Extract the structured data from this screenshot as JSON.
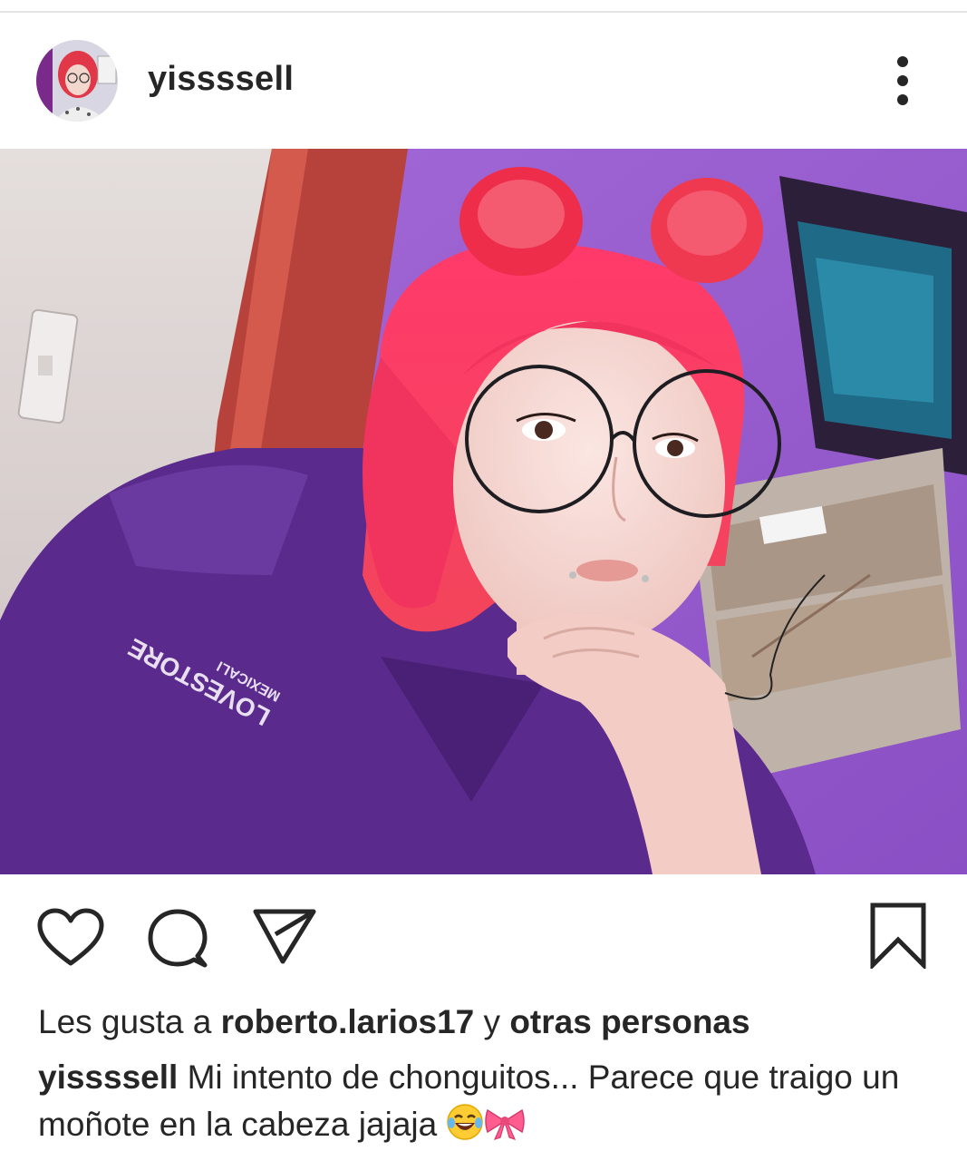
{
  "post": {
    "username": "yissssell",
    "more_icon": "more-vertical-icon"
  },
  "actions": {
    "like_icon": "heart-icon",
    "comment_icon": "comment-icon",
    "share_icon": "send-icon",
    "save_icon": "bookmark-icon"
  },
  "likes": {
    "prefix": "Les gusta a",
    "liker": "roberto.larios17",
    "joiner": "y",
    "others": "otras personas"
  },
  "caption": {
    "username": "yissssell",
    "text": "Mi intento de chonguitos... Parece que traigo un moñote en la cabeza jajaja",
    "emoji_1": "😂",
    "emoji_2": "🎀"
  },
  "photo": {
    "shirt_print_line1": "LOVESTORE",
    "shirt_print_line2": "MEXICALI"
  },
  "colors": {
    "text": "#262626",
    "shirt": "#5a2a8c",
    "wall": "#9b5fd0",
    "hair": "#f0345e",
    "door": "#b83a33"
  }
}
